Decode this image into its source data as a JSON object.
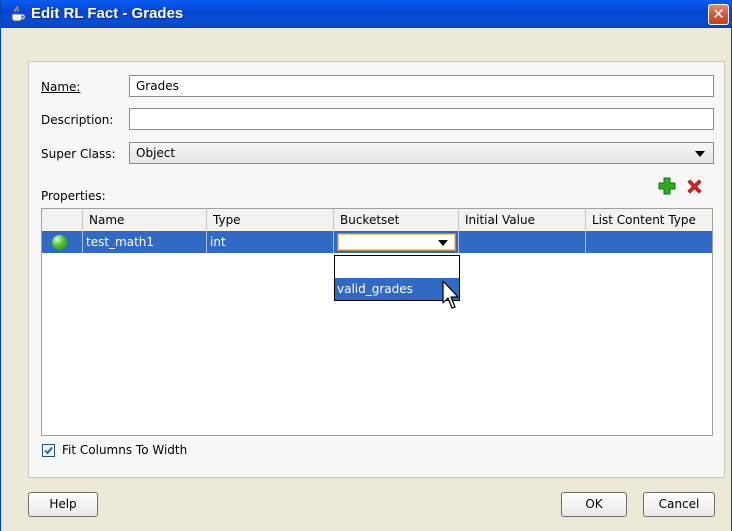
{
  "window": {
    "title": "Edit RL Fact - Grades",
    "close_glyph": "✕"
  },
  "form": {
    "name_label": "Name:",
    "name_value": "Grades",
    "description_label": "Description:",
    "description_value": "",
    "superclass_label": "Super Class:",
    "superclass_value": "Object",
    "properties_label": "Properties:"
  },
  "toolbar": {
    "add_icon": "plus-icon",
    "delete_icon": "delete-icon"
  },
  "table": {
    "columns": [
      "Name",
      "Type",
      "Bucketset",
      "Initial Value",
      "List Content Type"
    ],
    "rows": [
      {
        "name": "test_math1",
        "type": "int",
        "bucketset": "",
        "initial_value": "",
        "list_content_type": ""
      }
    ]
  },
  "bucketset_dropdown": {
    "options": [
      "",
      "valid_grades"
    ],
    "highlighted": "valid_grades"
  },
  "fit_columns": {
    "label": "Fit Columns To Width",
    "checked": true
  },
  "buttons": {
    "help": "Help",
    "ok": "OK",
    "cancel": "Cancel"
  },
  "colors": {
    "titlebar": "#0546d6",
    "selection": "#316ac5",
    "add": "#1aa31a",
    "delete": "#d11f1f"
  }
}
